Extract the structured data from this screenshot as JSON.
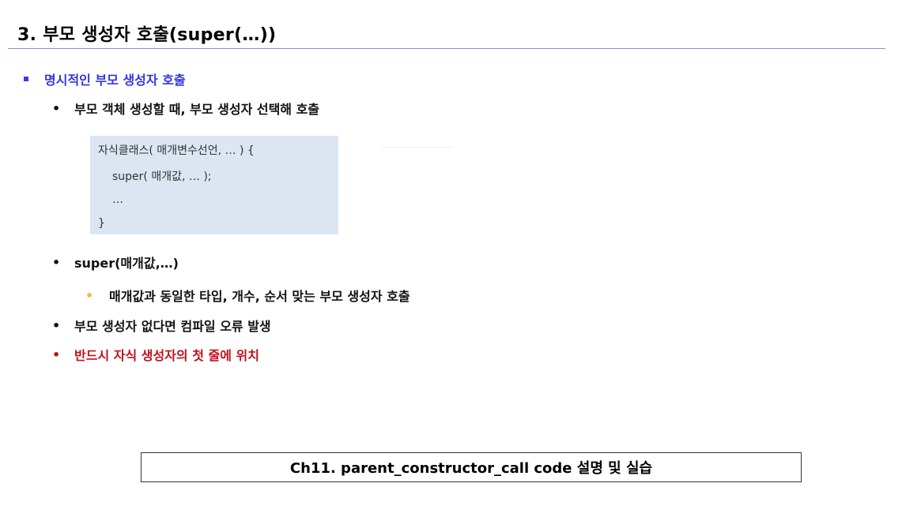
{
  "title": "3. 부모 생성자 호출(super(…))",
  "section": {
    "heading": "명시적인 부모 생성자 호출"
  },
  "bullets": {
    "b1": "부모 객체 생성할 때, 부모 생성자 선택해 호출",
    "b2": "super(매개값,…)",
    "b2_sub": "매개값과 동일한 타입, 개수, 순서 맞는 부모 생성자 호출",
    "b3": "부모 생성자 없다면 컴파일 오류 발생",
    "b4": "반드시 자식 생성자의 첫 줄에 위치"
  },
  "code": {
    "line1": "자식클래스( 매개변수선언, … ) {",
    "line2": "super( 매개값, … );",
    "line3": "…",
    "line4": "}"
  },
  "footer": "Ch11. parent_constructor_call  code 설명 및 실습",
  "colors": {
    "heading_blue": "#3434e0",
    "emphasis_red": "#c0121d",
    "code_bg": "#dbe6f2",
    "rule": "#8c8ee0"
  }
}
